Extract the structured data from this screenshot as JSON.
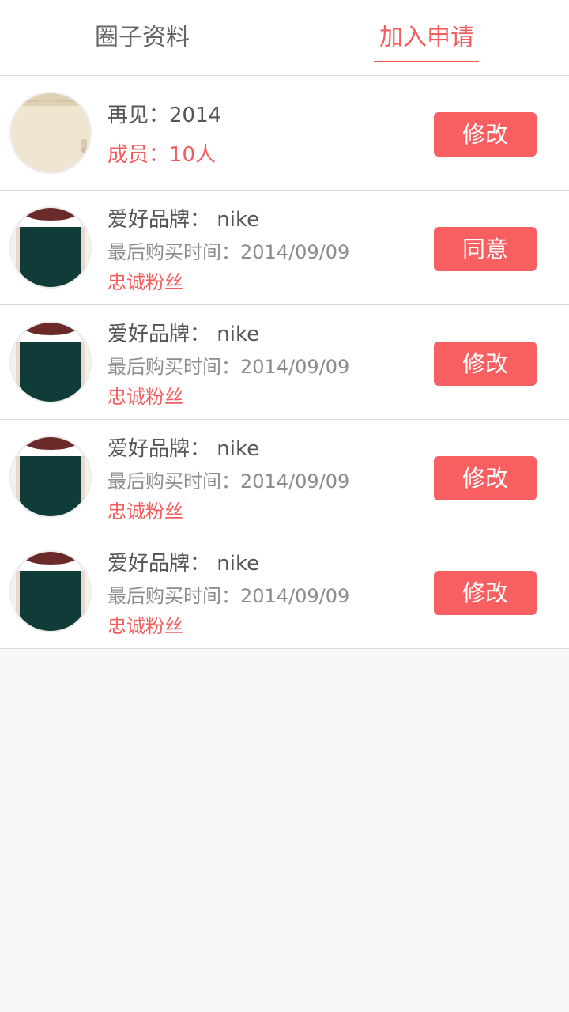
{
  "tabs": {
    "profile_label": "圈子资料",
    "requests_label": "加入申请",
    "active": "requests"
  },
  "group": {
    "name": "再见：2014",
    "members": "成员：10人",
    "button_label": "修改",
    "avatar_icon": "group-avatar-image"
  },
  "members": [
    {
      "brand": "爱好品牌： nike",
      "last_purchase": "最后购买时间：2014/09/09",
      "tag": "忠诚粉丝",
      "button_label": "同意",
      "avatar_icon": "user-avatar-image"
    },
    {
      "brand": "爱好品牌： nike",
      "last_purchase": "最后购买时间：2014/09/09",
      "tag": "忠诚粉丝",
      "button_label": "修改",
      "avatar_icon": "user-avatar-image"
    },
    {
      "brand": "爱好品牌： nike",
      "last_purchase": "最后购买时间：2014/09/09",
      "tag": "忠诚粉丝",
      "button_label": "修改",
      "avatar_icon": "user-avatar-image"
    },
    {
      "brand": "爱好品牌： nike",
      "last_purchase": "最后购买时间：2014/09/09",
      "tag": "忠诚粉丝",
      "button_label": "修改",
      "avatar_icon": "user-avatar-image"
    }
  ],
  "colors": {
    "accent": "#f35d5d",
    "button": "#f75f61",
    "text_primary": "#555555",
    "text_secondary": "#8c8c8c",
    "background": "#f8f8f8"
  }
}
